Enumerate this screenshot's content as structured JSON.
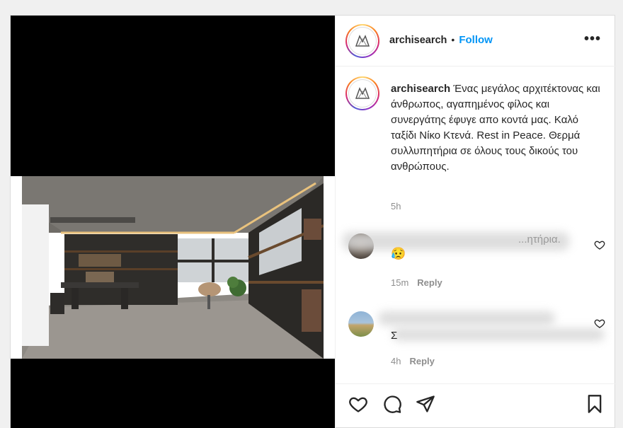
{
  "header": {
    "username": "archisearch",
    "separator": "•",
    "follow_label": "Follow",
    "more_label": "•••"
  },
  "caption": {
    "username": "archisearch",
    "text": "Ένας μεγάλος αρχιτέκτονας και άνθρωπος, αγαπημένος φίλος και συνεργάτης έφυγε απο κοντά μας. Καλό ταξίδι Νίκο Κτενά. Rest in Peace. Θερμά συλλυπητήρια σε όλους τους δικούς του ανθρώπους.",
    "time": "5h"
  },
  "comments": [
    {
      "text_partial": "...ητήρια.",
      "emoji": "😥",
      "time": "15m",
      "reply_label": "Reply"
    },
    {
      "text_partial": "Σ",
      "time": "4h",
      "reply_label": "Reply"
    }
  ],
  "actions": {
    "like": "heart-icon",
    "comment": "comment-icon",
    "share": "share-icon",
    "save": "bookmark-icon"
  },
  "colors": {
    "follow": "#0095f6",
    "text": "#262626",
    "muted": "#8e8e8e"
  }
}
